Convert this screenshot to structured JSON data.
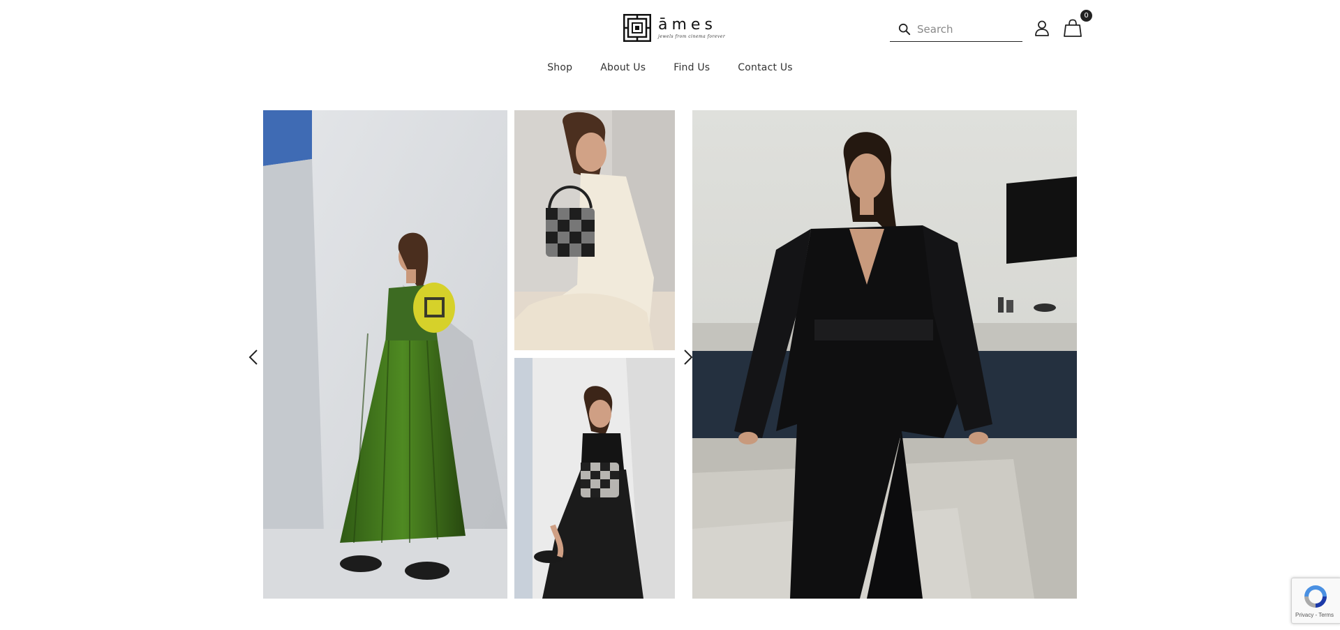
{
  "brand": {
    "name": "āmes",
    "tagline": "jewels from cinema forever"
  },
  "search": {
    "placeholder": "Search"
  },
  "cart": {
    "count": "0"
  },
  "nav": {
    "items": [
      {
        "label": "Shop"
      },
      {
        "label": "About Us"
      },
      {
        "label": "Find Us"
      },
      {
        "label": "Contact Us"
      }
    ]
  },
  "carousel": {
    "slides": [
      {
        "name": "Woman in green pleated dress with yellow handbag"
      },
      {
        "name": "Woman in cream knit dress with monogram handbag"
      },
      {
        "name": "Woman in black dress with monogram bag"
      },
      {
        "name": "Woman in black velvet suit"
      }
    ]
  },
  "recaptcha": {
    "text": "Privacy - Terms"
  },
  "colors": {
    "text": "#333333",
    "badge": "#222222",
    "background": "#ffffff"
  }
}
